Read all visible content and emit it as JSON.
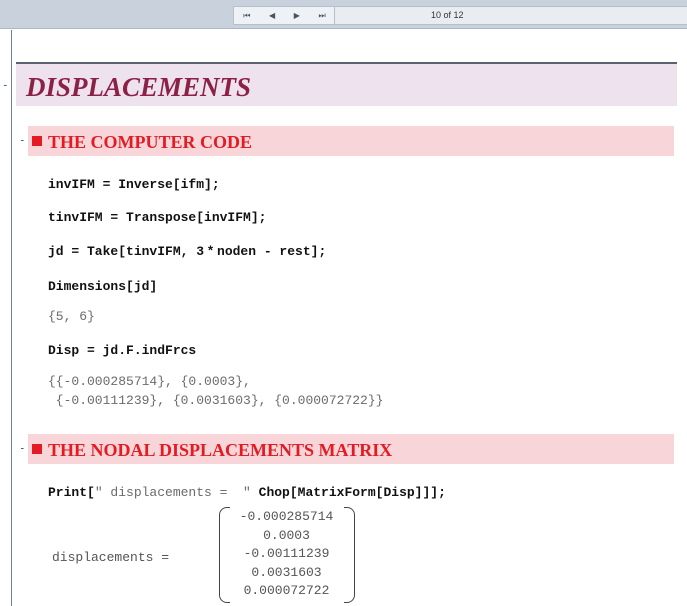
{
  "toolbar": {
    "first_icon": "⏮",
    "prev_icon": "◀",
    "next_icon": "▶",
    "last_icon": "⏭",
    "page_indicator": "10 of 12"
  },
  "sections": {
    "title": "DISPLACEMENTS",
    "code_header": "THE COMPUTER CODE",
    "matrix_header": "THE NODAL DISPLACEMENTS MATRIX"
  },
  "cells": {
    "c1": "invIFM = Inverse[ifm];",
    "c2": "tinvIFM = Transpose[invIFM];",
    "c3": "jd = Take[tinvIFM, 3 * noden - rest];",
    "c4": "Dimensions[jd]",
    "o4": "{5, 6}",
    "c5": "Disp = jd.F.indFrcs",
    "o5a": "{{-0.000285714}, {0.0003},",
    "o5b": " {-0.00111239}, {0.0031603}, {0.000072722}}",
    "c6_pre": "Print[",
    "c6_str": "\" displacements =  \"",
    "c6_post": " Chop[MatrixForm[Disp]]];"
  },
  "matrix": {
    "label": "displacements =",
    "rows": [
      "-0.000285714",
      "0.0003",
      "-0.00111239",
      "0.0031603",
      "0.000072722"
    ]
  }
}
